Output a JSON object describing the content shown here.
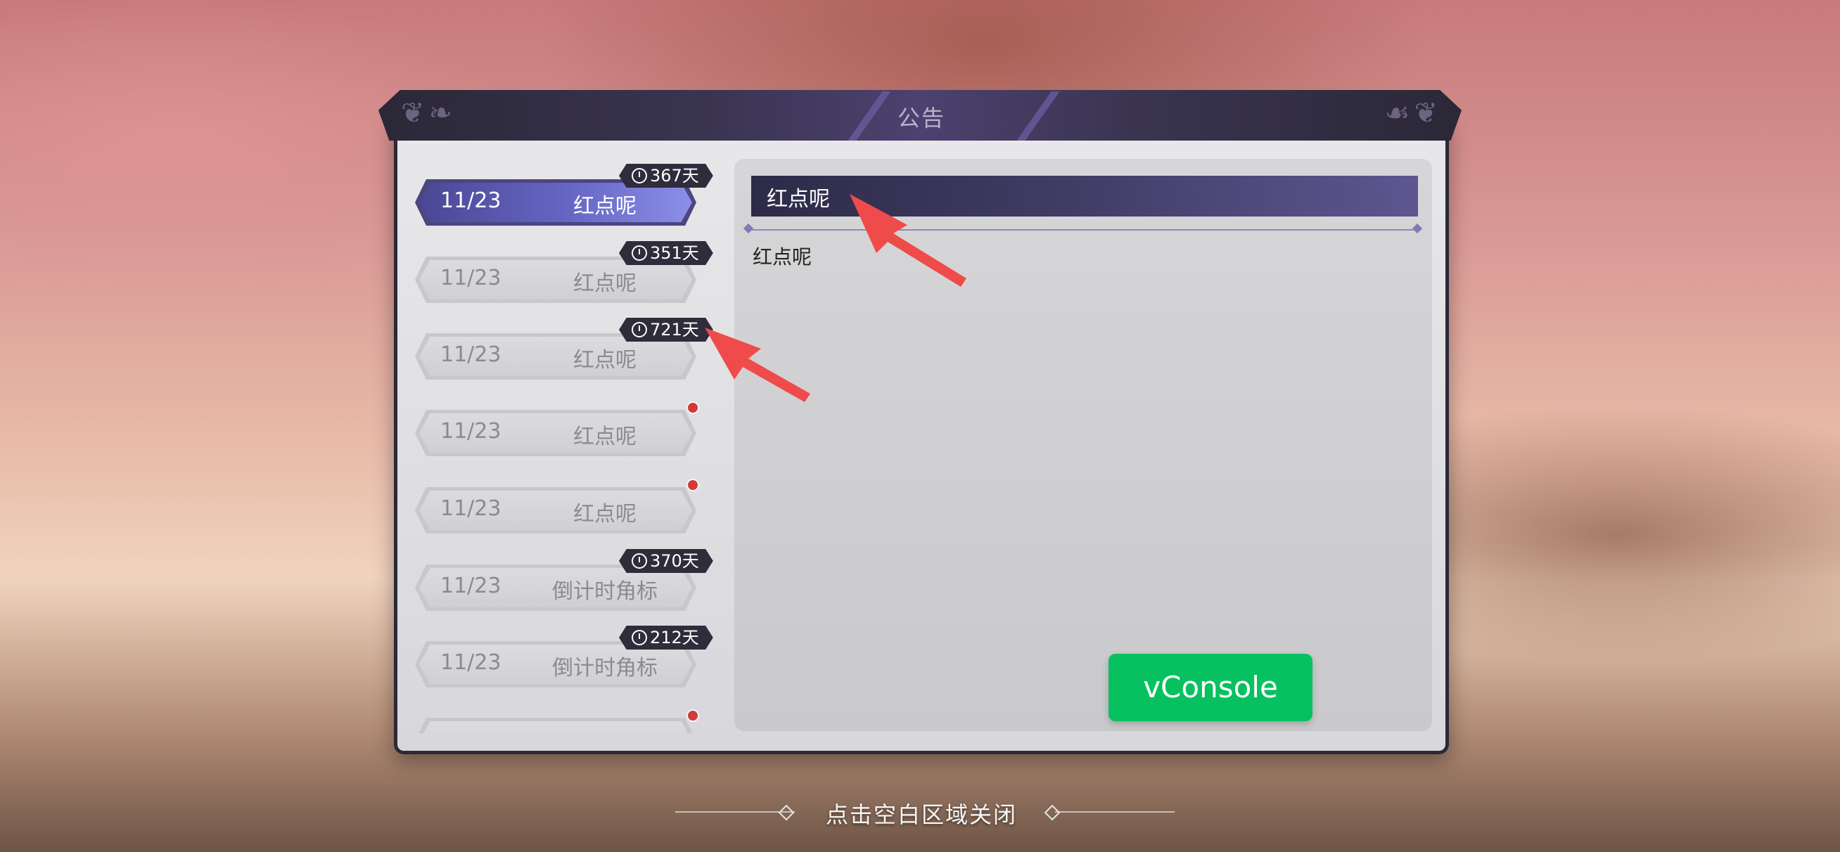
{
  "dialog": {
    "title": "公告"
  },
  "announcements": [
    {
      "date": "11/23",
      "title": "红点呢",
      "countdown": "367天",
      "active": true
    },
    {
      "date": "11/23",
      "title": "红点呢",
      "countdown": "351天"
    },
    {
      "date": "11/23",
      "title": "红点呢",
      "countdown": "721天"
    },
    {
      "date": "11/23",
      "title": "红点呢",
      "red_dot": true
    },
    {
      "date": "11/23",
      "title": "红点呢",
      "red_dot": true
    },
    {
      "date": "11/23",
      "title": "倒计时角标",
      "countdown": "370天"
    },
    {
      "date": "11/23",
      "title": "倒计时角标",
      "countdown": "212天"
    },
    {
      "date": "",
      "title": "",
      "red_dot": true
    }
  ],
  "detail": {
    "title": "红点呢",
    "body": "红点呢"
  },
  "vconsole": {
    "label": "vConsole"
  },
  "footer": {
    "close_hint": "点击空白区域关闭"
  },
  "colors": {
    "accent": "#5e5cb8",
    "vconsole": "#07c160",
    "red_dot": "#d03a3a",
    "arrow": "#ef4b4b"
  }
}
